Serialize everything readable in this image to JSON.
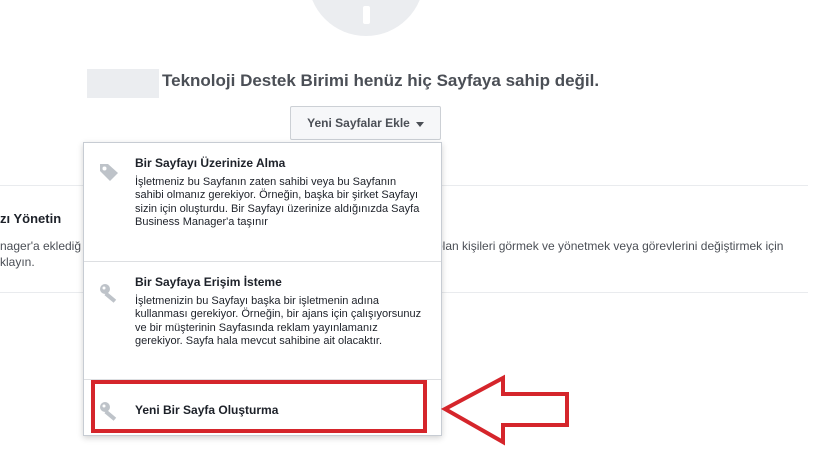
{
  "header": {
    "headline": "Teknoloji Destek Birimi henüz hiç Sayfaya sahip değil.",
    "add_pages_button": "Yeni Sayfalar Ekle"
  },
  "background": {
    "section_title_fragment": "zı Yönetin",
    "left_line1": "nager'a eklediğ",
    "left_line2": "klayın.",
    "right_line1": "olan kişileri görmek ve yönetmek veya görevlerini değiştirmek için"
  },
  "dropdown": {
    "items": [
      {
        "title": "Bir Sayfayı Üzerinize Alma",
        "description": "İşletmeniz bu Sayfanın zaten sahibi veya bu Sayfanın sahibi olmanız gerekiyor. Örneğin, başka bir şirket Sayfayı sizin için oluşturdu. Bir Sayfayı üzerinize aldığınızda Sayfa Business Manager'a taşınır",
        "icon": "tag-icon"
      },
      {
        "title": "Bir Sayfaya Erişim İsteme",
        "description": "İşletmenizin bu Sayfayı başka bir işletmenin adına kullanması gerekiyor. Örneğin, bir ajans için çalışıyorsunuz ve bir müşterinin Sayfasında reklam yayınlamanız gerekiyor. Sayfa hala mevcut sahibine ait olacaktır.",
        "icon": "key-icon"
      },
      {
        "title": "Yeni Bir Sayfa Oluşturma",
        "icon": "key-icon"
      }
    ]
  },
  "annotation": {
    "highlight_color": "#d5252b"
  }
}
